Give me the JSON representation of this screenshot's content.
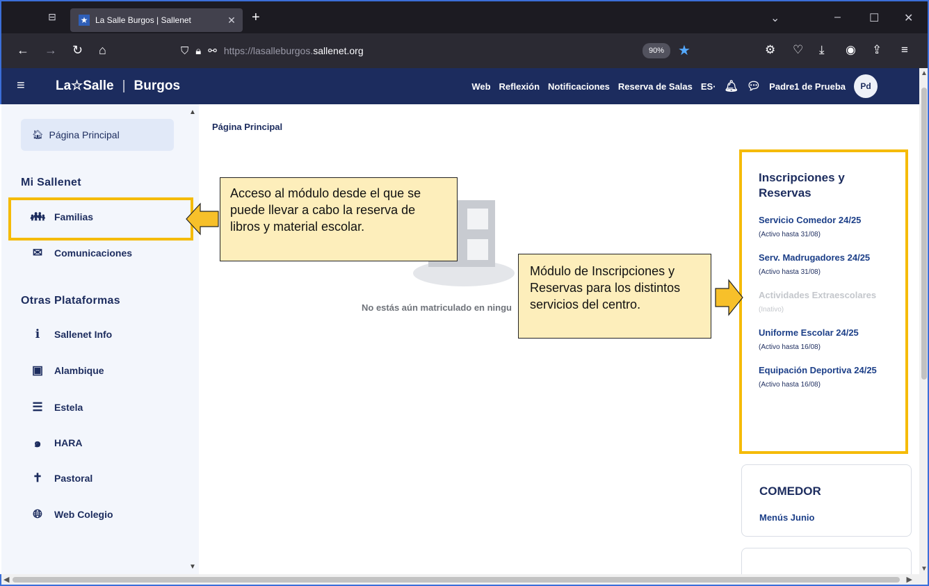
{
  "browser": {
    "tab_title": "La Salle Burgos | Sallenet",
    "url_prefix": "https://lasalleburgos.",
    "url_host": "sallenet.org",
    "zoom": "90%"
  },
  "header": {
    "logo_left": "La☆Salle",
    "logo_right": "Burgos",
    "menu": [
      "Web",
      "Reflexión",
      "Notificaciones",
      "Reserva de Salas",
      "ES·"
    ],
    "user_name": "Padre1 de Prueba",
    "avatar_initials": "Pd"
  },
  "sidebar": {
    "home": "Página Principal",
    "section1": "Mi Sallenet",
    "items1": [
      "Familias",
      "Comunicaciones"
    ],
    "section2": "Otras Plataformas",
    "items2": [
      "Sallenet Info",
      "Alambique",
      "Estela",
      "HARA",
      "Pastoral",
      "Web Colegio"
    ]
  },
  "main": {
    "breadcrumb": "Página Principal",
    "empty_message": "No estás aún matriculado en ninguna"
  },
  "panel": {
    "title": "Inscripciones y Reservas",
    "items": [
      {
        "name": "Servicio Comedor 24/25",
        "status": "(Activo hasta 31/08)"
      },
      {
        "name": "Serv. Madrugadores 24/25",
        "status": "(Activo hasta 31/08)"
      },
      {
        "name": "Actividades Extraescolares",
        "status": "(Inativo)"
      },
      {
        "name": "Uniforme Escolar 24/25",
        "status": "(Activo hasta 16/08)"
      },
      {
        "name": "Equipación Deportiva 24/25",
        "status": "(Activo hasta 16/08)"
      }
    ]
  },
  "comedor": {
    "title": "COMEDOR",
    "link": "Menús Junio"
  },
  "annotations": {
    "note1": "Acceso al módulo desde el que se puede llevar a cabo la reserva de libros y material escolar.",
    "note2": "Módulo de Inscripciones y Reservas para los distintos servicios del centro."
  },
  "colors": {
    "navy": "#1c2c5e",
    "highlight": "#f5bb08",
    "note_bg": "#fdeebb"
  }
}
